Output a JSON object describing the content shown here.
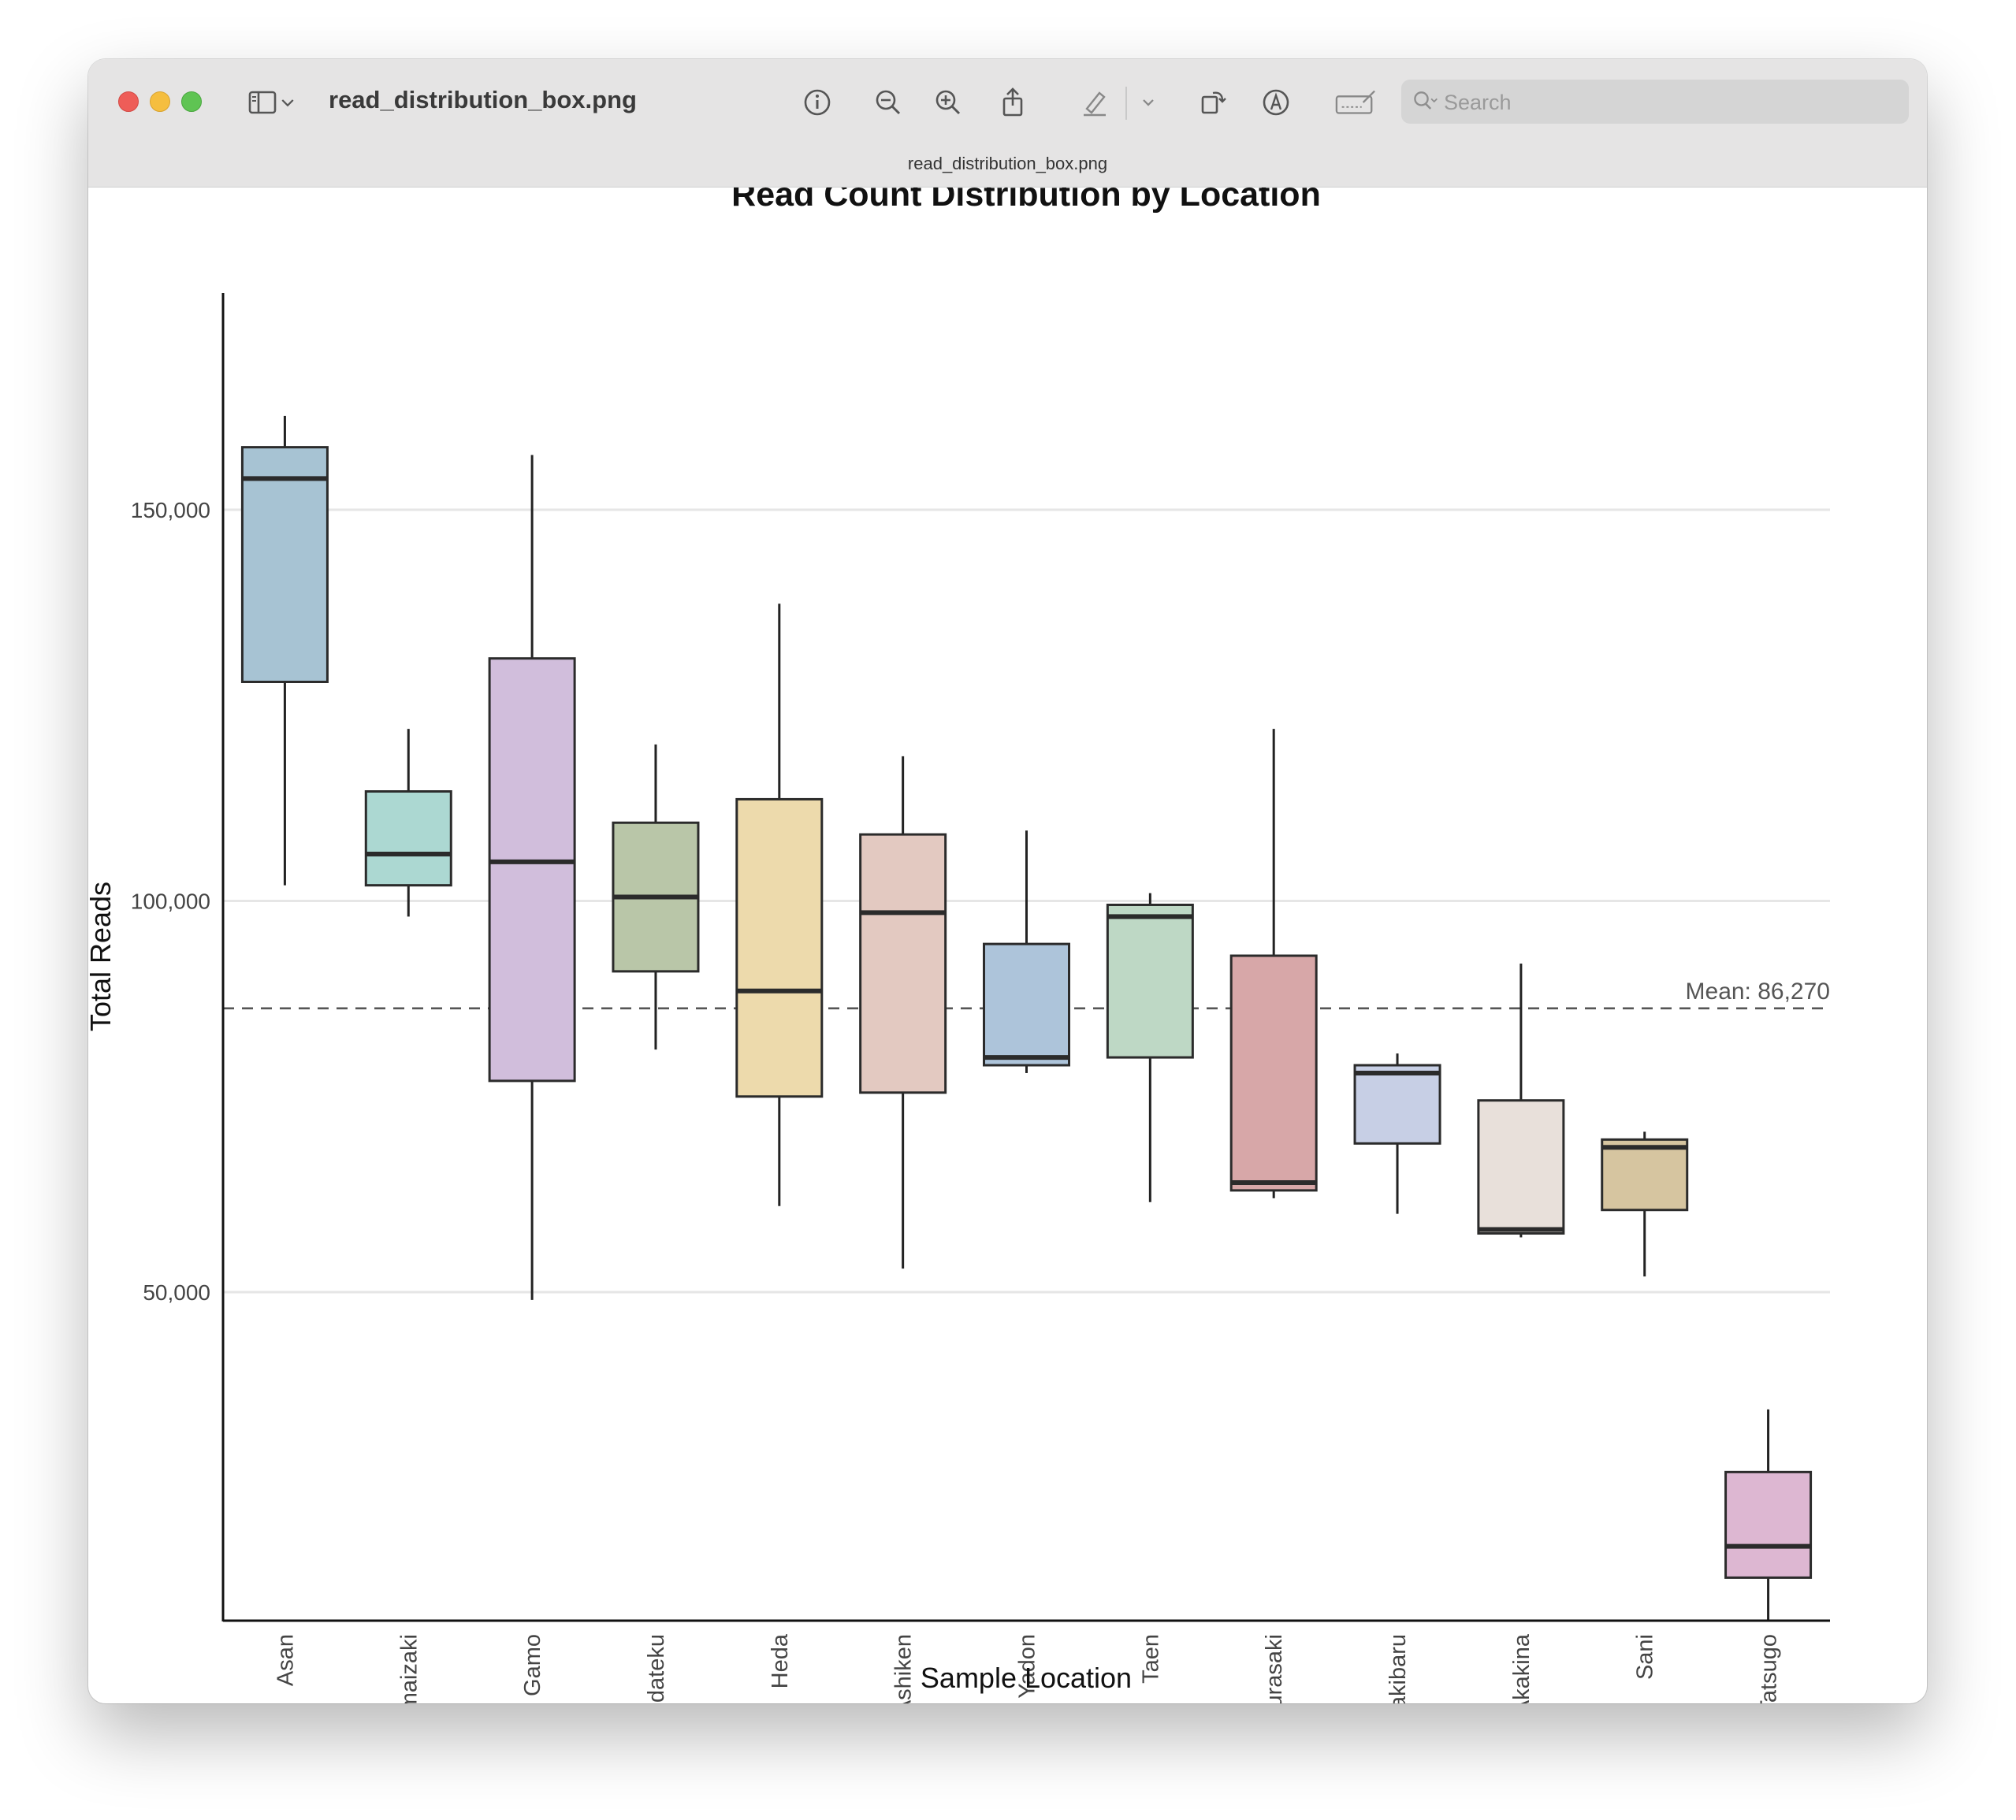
{
  "window": {
    "title": "read_distribution_box.png",
    "subtitle": "read_distribution_box.png",
    "search_placeholder": "Search"
  },
  "toolbar": {
    "icons": [
      "sidebar-icon",
      "chevron-down-icon",
      "info-icon",
      "zoom-out-icon",
      "zoom-in-icon",
      "share-icon",
      "highlight-pen-icon",
      "chevron-down-icon",
      "rotate-icon",
      "markup-icon",
      "signature-icon",
      "search-icon"
    ]
  },
  "chart_data": {
    "type": "box",
    "title": "Read Count Distribution by Location",
    "xlabel": "Sample Location",
    "ylabel": "Total Reads",
    "ylim": [
      8000,
      177500
    ],
    "yticks": [
      50000,
      100000,
      150000
    ],
    "ytick_labels": [
      "50,000",
      "100,000",
      "150,000"
    ],
    "grid": "horizontal",
    "mean": {
      "value": 86270,
      "label": "Mean: 86,270"
    },
    "categories": [
      "Asan",
      "Imaizaki",
      "Gamo",
      "Edateku",
      "Heda",
      "Ashiken",
      "Yadon",
      "Taen",
      "Kurasaki",
      "Sakibaru",
      "Akakina",
      "Sani",
      "Tatsugo"
    ],
    "boxes": [
      {
        "name": "Asan",
        "min": 102000,
        "q1": 128000,
        "median": 154000,
        "q3": 158000,
        "max": 162000,
        "color": "#a7c3d3"
      },
      {
        "name": "Imaizaki",
        "min": 98000,
        "q1": 102000,
        "median": 106000,
        "q3": 114000,
        "max": 122000,
        "color": "#acd8d2"
      },
      {
        "name": "Gamo",
        "min": 49000,
        "q1": 77000,
        "median": 105000,
        "q3": 131000,
        "max": 157000,
        "color": "#d1bedc"
      },
      {
        "name": "Edateku",
        "min": 81000,
        "q1": 91000,
        "median": 100500,
        "q3": 110000,
        "max": 120000,
        "color": "#b9c6a8"
      },
      {
        "name": "Heda",
        "min": 61000,
        "q1": 75000,
        "median": 88500,
        "q3": 113000,
        "max": 138000,
        "color": "#eddaac"
      },
      {
        "name": "Ashiken",
        "min": 53000,
        "q1": 75500,
        "median": 98500,
        "q3": 108500,
        "max": 118500,
        "color": "#e3c9c1"
      },
      {
        "name": "Yadon",
        "min": 78000,
        "q1": 79000,
        "median": 80000,
        "q3": 94500,
        "max": 109000,
        "color": "#adc4da"
      },
      {
        "name": "Taen",
        "min": 61500,
        "q1": 80000,
        "median": 98000,
        "q3": 99500,
        "max": 101000,
        "color": "#bed8c5"
      },
      {
        "name": "Kurasaki",
        "min": 62000,
        "q1": 63000,
        "median": 64000,
        "q3": 93000,
        "max": 122000,
        "color": "#d7a7a8"
      },
      {
        "name": "Sakibaru",
        "min": 60000,
        "q1": 69000,
        "median": 78000,
        "q3": 79000,
        "max": 80500,
        "color": "#c7cfe5"
      },
      {
        "name": "Akakina",
        "min": 57000,
        "q1": 57500,
        "median": 58000,
        "q3": 74500,
        "max": 92000,
        "color": "#e8e0da"
      },
      {
        "name": "Sani",
        "min": 52000,
        "q1": 60500,
        "median": 68500,
        "q3": 69500,
        "max": 70500,
        "color": "#d6c5a0"
      },
      {
        "name": "Tatsugo",
        "min": 8000,
        "q1": 13500,
        "median": 17500,
        "q3": 27000,
        "max": 35000,
        "color": "#ddb7d2"
      }
    ]
  }
}
